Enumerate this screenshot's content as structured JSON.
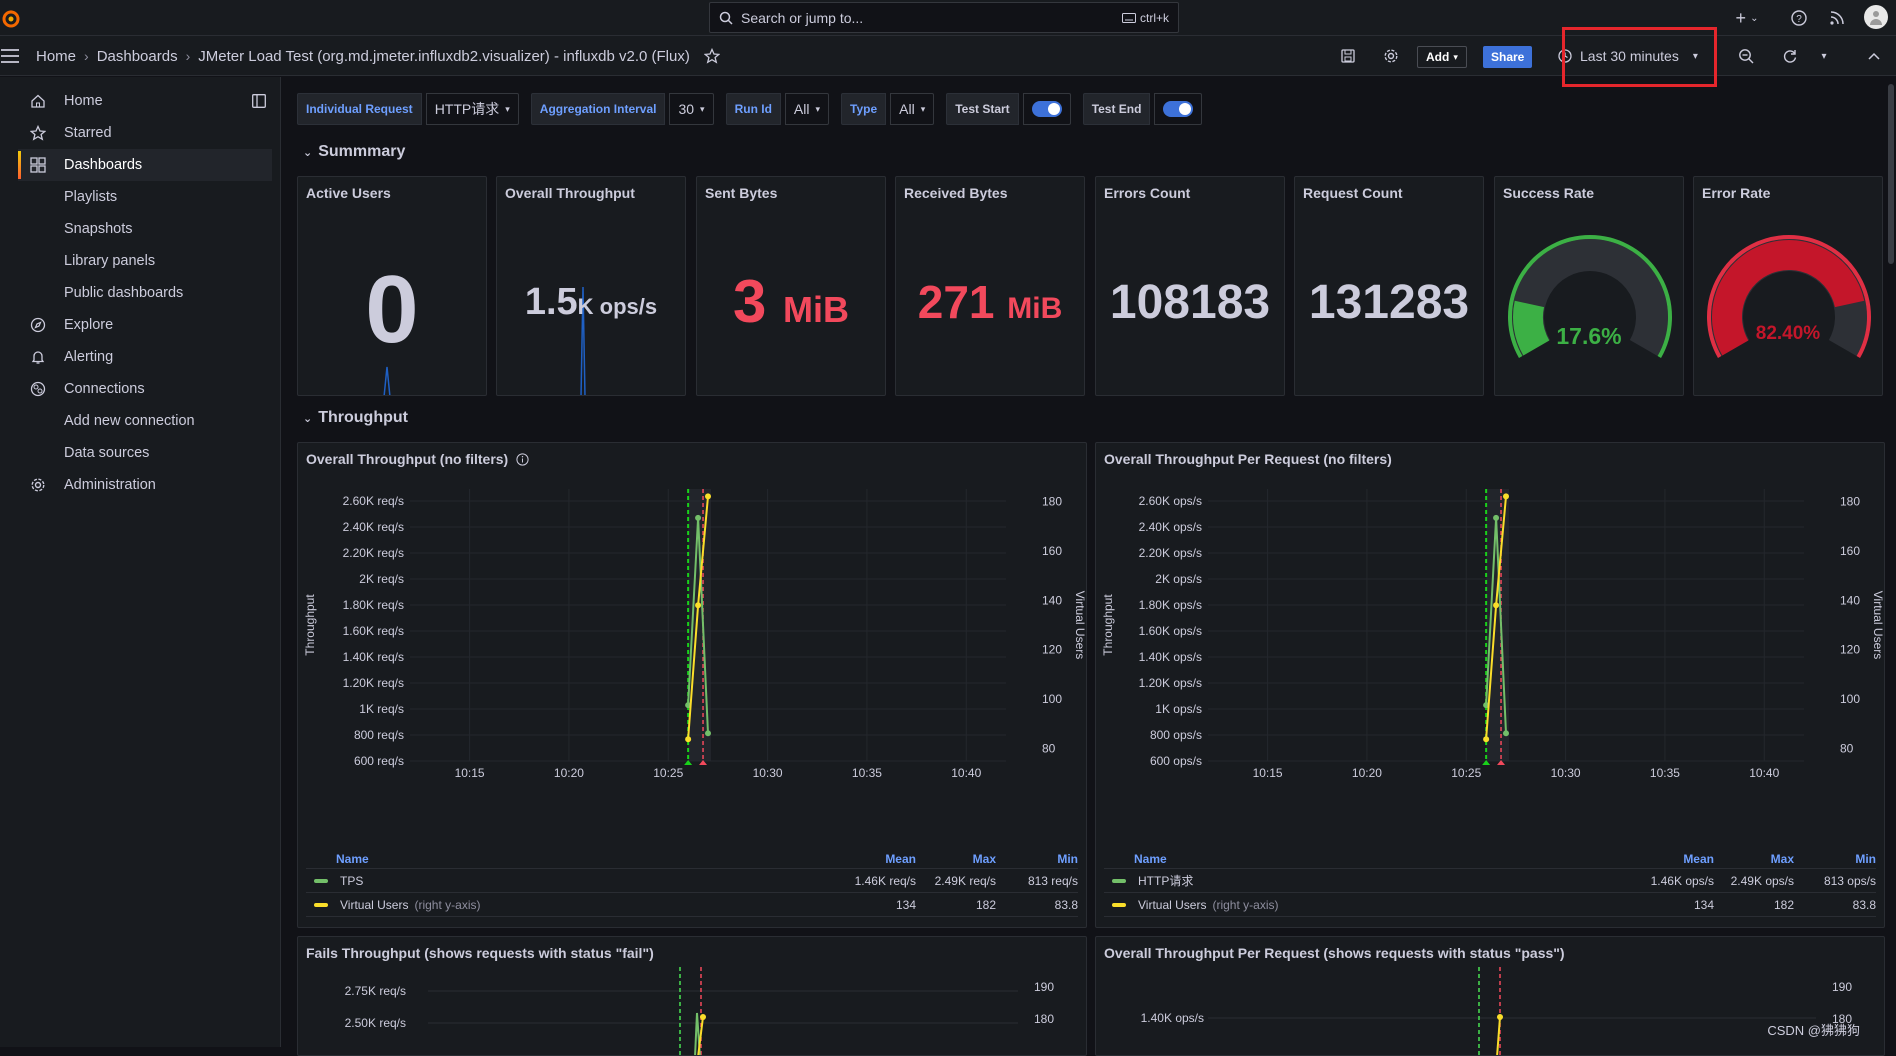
{
  "topbar": {
    "search_placeholder": "Search or jump to...",
    "search_shortcut": "ctrl+k"
  },
  "breadcrumb": {
    "home": "Home",
    "dashboards": "Dashboards",
    "title": "JMeter Load Test (org.md.jmeter.influxdb2.visualizer) - influxdb v2.0 (Flux)"
  },
  "toolbar": {
    "add_label": "Add",
    "share_label": "Share",
    "time_range": "Last 30 minutes"
  },
  "sidebar": {
    "items": [
      {
        "label": "Home",
        "icon": "home-icon"
      },
      {
        "label": "Starred",
        "icon": "star-icon"
      },
      {
        "label": "Dashboards",
        "icon": "dashboards-icon"
      },
      {
        "label": "Playlists"
      },
      {
        "label": "Snapshots"
      },
      {
        "label": "Library panels"
      },
      {
        "label": "Public dashboards"
      },
      {
        "label": "Explore",
        "icon": "compass-icon"
      },
      {
        "label": "Alerting",
        "icon": "bell-icon"
      },
      {
        "label": "Connections",
        "icon": "plug-icon"
      },
      {
        "label": "Add new connection"
      },
      {
        "label": "Data sources"
      },
      {
        "label": "Administration",
        "icon": "cog-icon"
      }
    ]
  },
  "variables": {
    "individual_request": {
      "label": "Individual Request",
      "value": "HTTP请求"
    },
    "aggregation_interval": {
      "label": "Aggregation Interval",
      "value": "30"
    },
    "run_id": {
      "label": "Run Id",
      "value": "All"
    },
    "type": {
      "label": "Type",
      "value": "All"
    },
    "test_start": {
      "label": "Test Start"
    },
    "test_end": {
      "label": "Test End"
    }
  },
  "rows": {
    "summary": "Summmary",
    "throughput": "Throughput"
  },
  "stats": [
    {
      "title": "Active Users",
      "value": "0",
      "unit": "",
      "color": "#ccccdc"
    },
    {
      "title": "Overall Throughput",
      "value": "1.5",
      "unit": "K ops/s",
      "color": "#ccccdc"
    },
    {
      "title": "Sent Bytes",
      "value": "3",
      "unit": "MiB",
      "color": "#f2495c"
    },
    {
      "title": "Received Bytes",
      "value": "271",
      "unit": "MiB",
      "color": "#f2495c"
    },
    {
      "title": "Errors Count",
      "value": "108183",
      "unit": "",
      "color": "#ccccdc"
    },
    {
      "title": "Request Count",
      "value": "131283",
      "unit": "",
      "color": "#ccccdc"
    },
    {
      "title": "Success Rate",
      "value": "17.6%",
      "color": "#3cb045"
    },
    {
      "title": "Error Rate",
      "value": "82.40%",
      "color": "#c4162a"
    }
  ],
  "gauges": {
    "success_fraction": 0.176,
    "error_fraction": 0.824
  },
  "legend_headers": {
    "name": "Name",
    "mean": "Mean",
    "max": "Max",
    "min": "Min"
  },
  "throughput_panels": [
    {
      "title": "Overall Throughput (no filters)",
      "ylabel": "Throughput",
      "y2label": "Virtual Users",
      "legend": [
        {
          "name": "TPS",
          "suffix": "",
          "mean": "1.46K req/s",
          "max": "2.49K req/s",
          "min": "813 req/s",
          "color": "#73bf69"
        },
        {
          "name": "Virtual Users",
          "suffix": "(right y-axis)",
          "mean": "134",
          "max": "182",
          "min": "83.8",
          "color": "#fade2a"
        }
      ]
    },
    {
      "title": "Overall Throughput Per Request (no filters)",
      "ylabel": "Throughput",
      "y2label": "Virtual Users",
      "legend": [
        {
          "name": "HTTP请求",
          "suffix": "",
          "mean": "1.46K ops/s",
          "max": "2.49K ops/s",
          "min": "813 ops/s",
          "color": "#73bf69"
        },
        {
          "name": "Virtual Users",
          "suffix": "(right y-axis)",
          "mean": "134",
          "max": "182",
          "min": "83.8",
          "color": "#fade2a"
        }
      ]
    }
  ],
  "bottom_panels": [
    {
      "title": "Fails Throughput (shows requests with status \"fail\")"
    },
    {
      "title": "Overall Throughput Per Request (shows requests with status \"pass\")"
    }
  ],
  "chart_data": [
    {
      "type": "line",
      "title": "Overall Throughput (no filters)",
      "ylabel": "Throughput",
      "y2label": "Virtual Users",
      "x_ticks": [
        "10:15",
        "10:20",
        "10:25",
        "10:30",
        "10:35",
        "10:40"
      ],
      "y_ticks": [
        "600 req/s",
        "800 req/s",
        "1K req/s",
        "1.20K req/s",
        "1.40K req/s",
        "1.60K req/s",
        "1.80K req/s",
        "2K req/s",
        "2.20K req/s",
        "2.40K req/s",
        "2.60K req/s"
      ],
      "y2_ticks": [
        "80",
        "100",
        "120",
        "140",
        "160",
        "180"
      ],
      "ylim": [
        600,
        2600
      ],
      "y2lim": [
        75,
        185
      ],
      "series": [
        {
          "name": "TPS",
          "color": "#73bf69",
          "points": [
            [
              "10:26:00",
              1030
            ],
            [
              "10:26:30",
              2470
            ],
            [
              "10:27:00",
              813
            ]
          ]
        },
        {
          "name": "Virtual Users",
          "color": "#fade2a",
          "axis": "right",
          "points": [
            [
              "10:26:00",
              83.8
            ],
            [
              "10:26:30",
              138
            ],
            [
              "10:27:00",
              182
            ]
          ]
        }
      ],
      "annotations": [
        {
          "time": "10:26:00",
          "color": "#37872d"
        },
        {
          "time": "10:26:45",
          "color": "#f2495c"
        }
      ]
    },
    {
      "type": "line",
      "title": "Overall Throughput Per Request (no filters)",
      "ylabel": "Throughput",
      "y2label": "Virtual Users",
      "x_ticks": [
        "10:15",
        "10:20",
        "10:25",
        "10:30",
        "10:35",
        "10:40"
      ],
      "y_ticks": [
        "600 ops/s",
        "800 ops/s",
        "1K ops/s",
        "1.20K ops/s",
        "1.40K ops/s",
        "1.60K ops/s",
        "1.80K ops/s",
        "2K ops/s",
        "2.20K ops/s",
        "2.40K ops/s",
        "2.60K ops/s"
      ],
      "y2_ticks": [
        "80",
        "100",
        "120",
        "140",
        "160",
        "180"
      ],
      "ylim": [
        600,
        2600
      ],
      "y2lim": [
        75,
        185
      ],
      "series": [
        {
          "name": "HTTP请求",
          "color": "#73bf69",
          "points": [
            [
              "10:26:00",
              1030
            ],
            [
              "10:26:30",
              2470
            ],
            [
              "10:27:00",
              813
            ]
          ]
        },
        {
          "name": "Virtual Users",
          "color": "#fade2a",
          "axis": "right",
          "points": [
            [
              "10:26:00",
              83.8
            ],
            [
              "10:26:30",
              138
            ],
            [
              "10:27:00",
              182
            ]
          ]
        }
      ],
      "annotations": [
        {
          "time": "10:26:00",
          "color": "#37872d"
        },
        {
          "time": "10:26:45",
          "color": "#f2495c"
        }
      ]
    }
  ],
  "bottom_chart_ticks": {
    "left": {
      "y_ticks": [
        "2.75K req/s",
        "2.50K req/s"
      ],
      "y2_ticks": [
        "190",
        "180"
      ]
    },
    "right": {
      "y_ticks": [
        "1.40K ops/s"
      ],
      "y2_ticks": [
        "190",
        "180"
      ]
    }
  },
  "watermark": "CSDN @狒狒狗"
}
